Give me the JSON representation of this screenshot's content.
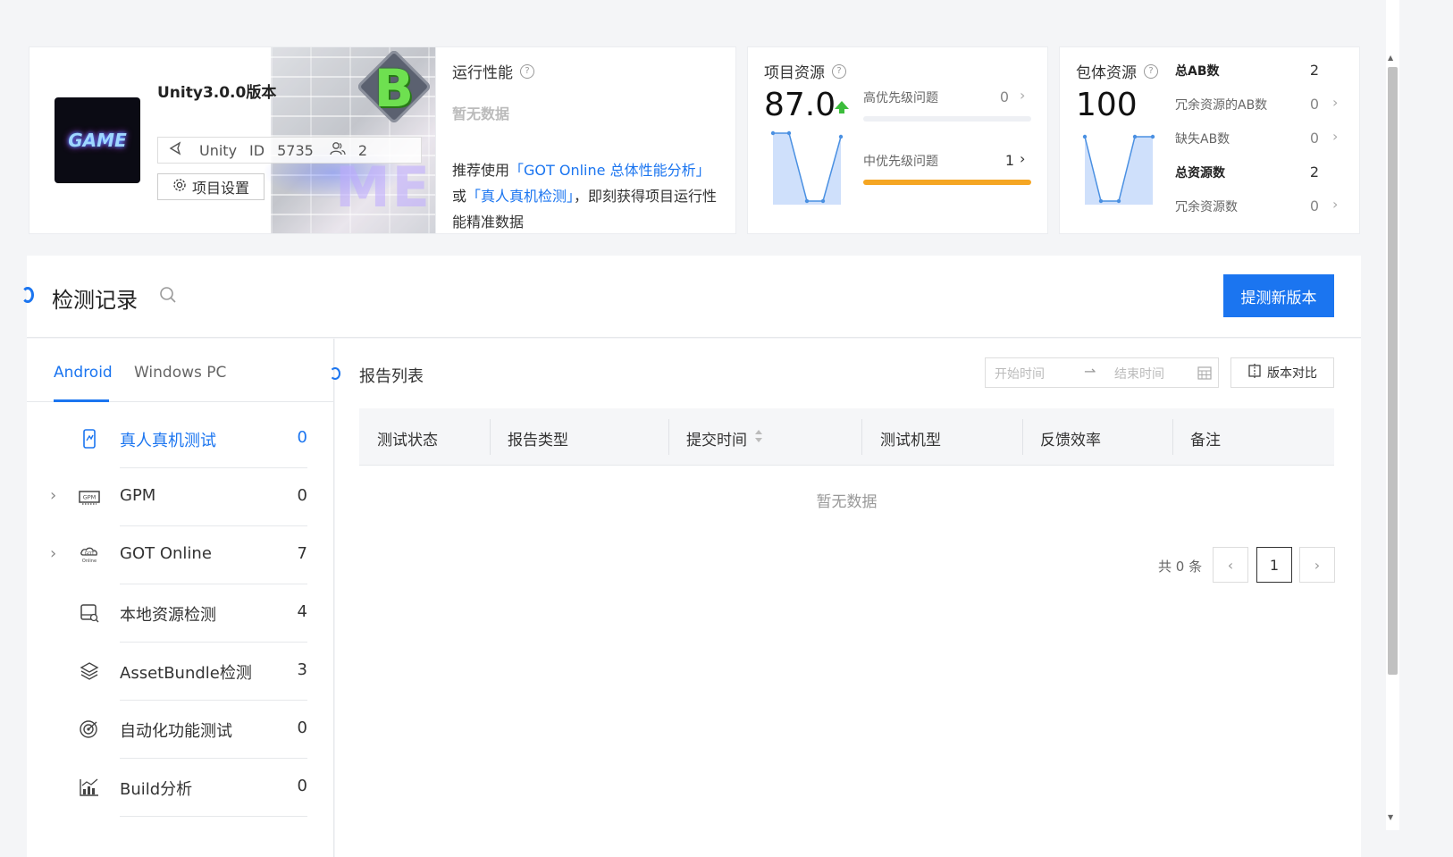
{
  "project": {
    "title": "Unity3.0.0版本",
    "engine": "Unity",
    "id_label": "ID",
    "id_value": "5735",
    "members": "2",
    "settings_label": "项目设置",
    "thumb_text": "GAME",
    "badge_letter": "B",
    "bg_text": "ME"
  },
  "perf": {
    "title": "运行性能",
    "nodata": "暂无数据",
    "text_prefix": "推荐使用",
    "link1": "「GOT Online 总体性能分析」",
    "text_or": "或",
    "link2": "「真人真机检测」",
    "text_suffix": "，即刻获得项目运行性能精准数据"
  },
  "resources": {
    "title": "项目资源",
    "score": "87.0",
    "trend": "up",
    "high_label": "高优先级问题",
    "high_value": "0",
    "mid_label": "中优先级问题",
    "mid_value": "1",
    "sparkline": [
      87.0,
      86,
      40,
      40,
      86
    ]
  },
  "package": {
    "title": "包体资源",
    "score": "100",
    "rows": [
      {
        "label": "总AB数",
        "value": "2",
        "bold": true
      },
      {
        "label": "冗余资源的AB数",
        "value": "0",
        "bold": false
      },
      {
        "label": "缺失AB数",
        "value": "0",
        "bold": false
      },
      {
        "label": "总资源数",
        "value": "2",
        "bold": true
      },
      {
        "label": "冗余资源数",
        "value": "0",
        "bold": false
      }
    ]
  },
  "records": {
    "title": "检测记录",
    "submit_label": "提测新版本"
  },
  "tabs": [
    "Android",
    "Windows PC"
  ],
  "tools": [
    {
      "label": "真人真机测试",
      "count": "0",
      "icon": "phone-test-icon",
      "expandable": false
    },
    {
      "label": "GPM",
      "count": "0",
      "icon": "gpm-icon",
      "expandable": true
    },
    {
      "label": "GOT Online",
      "count": "7",
      "icon": "got-online-icon",
      "expandable": true
    },
    {
      "label": "本地资源检测",
      "count": "4",
      "icon": "local-resource-icon",
      "expandable": false
    },
    {
      "label": "AssetBundle检测",
      "count": "3",
      "icon": "assetbundle-icon",
      "expandable": false
    },
    {
      "label": "自动化功能测试",
      "count": "0",
      "icon": "auto-test-icon",
      "expandable": false
    },
    {
      "label": "Build分析",
      "count": "0",
      "icon": "build-analysis-icon",
      "expandable": false
    }
  ],
  "report": {
    "title": "报告列表",
    "start_placeholder": "开始时间",
    "end_placeholder": "结束时间",
    "compare_label": "版本对比",
    "columns": [
      "测试状态",
      "报告类型",
      "提交时间",
      "测试机型",
      "反馈效率",
      "备注"
    ],
    "empty": "暂无数据",
    "total": "共 0 条",
    "page": "1"
  },
  "colors": {
    "accent": "#1b75f0",
    "warning": "#f5a623",
    "success": "#3cbd3c"
  }
}
